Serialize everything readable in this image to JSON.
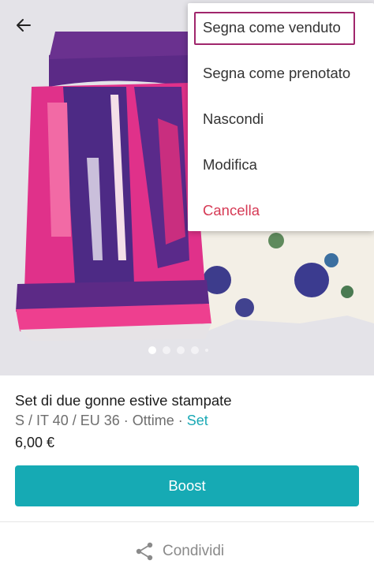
{
  "header": {
    "back_icon": "arrow-left-icon"
  },
  "photo": {
    "carousel_total": 5,
    "carousel_active_index": 0
  },
  "menu": {
    "items": [
      {
        "label": "Segna come venduto",
        "highlighted": true
      },
      {
        "label": "Segna come prenotato"
      },
      {
        "label": "Nascondi"
      },
      {
        "label": "Modifica"
      },
      {
        "label": "Cancella",
        "danger": true
      }
    ]
  },
  "item": {
    "title": "Set di due gonne estive stampate",
    "meta_prefix": "S / IT 40 / EU 36 · Ottime · ",
    "meta_link": "Set",
    "price": "6,00 €"
  },
  "actions": {
    "boost_label": "Boost",
    "share_label": "Condividi",
    "share_icon": "share-icon"
  },
  "colors": {
    "accent": "#16aab4",
    "danger": "#d63a55",
    "highlight_border": "#a0266c"
  }
}
